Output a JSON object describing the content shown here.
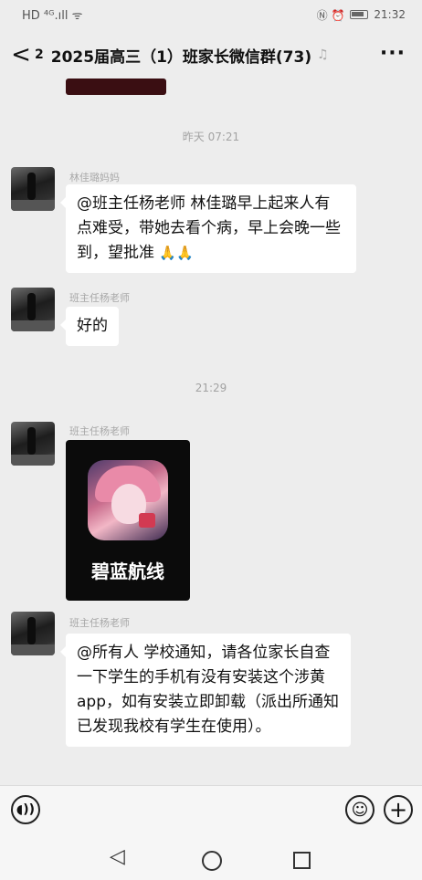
{
  "status_bar": {
    "left_text": "HD ⁴ᴳ.ıll ᯤ",
    "right_icons": "Ⓝ ⏰",
    "time": "21:32"
  },
  "header": {
    "back_label": "<",
    "unread_count": "2",
    "title": "2025届高三（1）班家长微信群(73)",
    "more_label": "···"
  },
  "messages": [
    {
      "time_divider": "昨天 07:21",
      "sender": "林佳璐妈妈",
      "text": "@班主任杨老师  林佳璐早上起来人有点难受，带她去看个病，早上会晚一些到，望批准",
      "emoji": "🙏🙏"
    },
    {
      "sender": "班主任杨老师",
      "text": "好的"
    },
    {
      "time_divider": "21:29",
      "sender": "班主任杨老师",
      "image_app_name": "碧蓝航线"
    },
    {
      "sender": "班主任杨老师",
      "text": "@所有人  学校通知，请各位家长自查一下学生的手机有没有安装这个涉黄 app，如有安装立即卸载（派出所通知已发现我校有学生在使用）。"
    }
  ],
  "input_bar": {
    "voice_icon": "voice-icon",
    "emoji_icon": "emoji-icon",
    "plus_icon": "plus-icon"
  }
}
